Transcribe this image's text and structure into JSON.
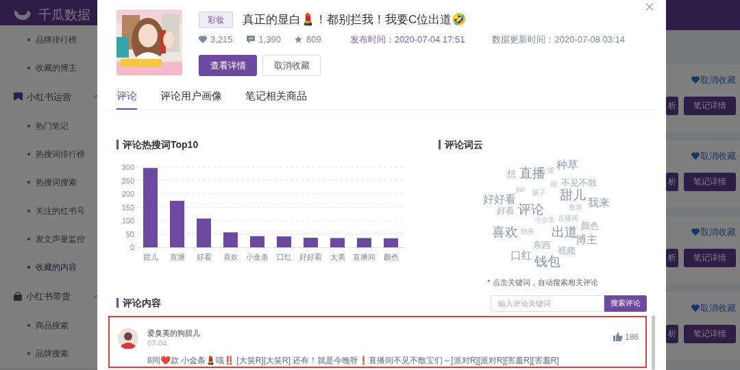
{
  "header": {
    "logo_text": "千瓜数据"
  },
  "sidebar": {
    "items": [
      {
        "kind": "link",
        "label": "品牌排行榜",
        "selected": false
      },
      {
        "kind": "link",
        "label": "收藏的博主",
        "selected": false
      },
      {
        "kind": "section",
        "label": "小红书运营",
        "expanded": true
      },
      {
        "kind": "link",
        "label": "热门笔记",
        "selected": false
      },
      {
        "kind": "link",
        "label": "热搜词排行榜",
        "selected": false
      },
      {
        "kind": "link",
        "label": "热搜词搜索",
        "selected": false
      },
      {
        "kind": "link",
        "label": "关注的红书号",
        "selected": false
      },
      {
        "kind": "link",
        "label": "发文声量监控",
        "selected": false
      },
      {
        "kind": "link",
        "label": "收藏的内容",
        "selected": true
      },
      {
        "kind": "section",
        "label": "小红书带货",
        "expanded": true
      },
      {
        "kind": "link",
        "label": "商品搜索",
        "selected": false
      },
      {
        "kind": "link",
        "label": "品牌搜索",
        "selected": false
      }
    ]
  },
  "background_cards": [
    {
      "unfavorite": "取消收藏",
      "buttons": [
        "析",
        "笔记详情"
      ]
    },
    {
      "unfavorite": "取消收藏",
      "buttons": [
        "析",
        "笔记详情"
      ]
    },
    {
      "unfavorite": "取消收藏",
      "buttons": [
        "析",
        "笔记详情"
      ]
    },
    {
      "unfavorite": "取消收藏",
      "buttons": [
        "析",
        "笔记详情"
      ]
    }
  ],
  "modal": {
    "note": {
      "tag": "彩妆",
      "title": "真正的显白💄！都别拦我！我要C位出道🤣",
      "likes": "3,215",
      "comments": "1,390",
      "favorites": "809",
      "publish_label": "发布时间：",
      "publish_time": "2020-07-04 17:51",
      "update_label": "数据更新时间：",
      "update_time": "2020-07-08 03:14"
    },
    "actions": [
      {
        "label": "查看详情",
        "kind": "primary"
      },
      {
        "label": "取消收藏",
        "kind": "secondary"
      }
    ],
    "tabs": [
      {
        "label": "评论",
        "selected": true
      },
      {
        "label": "评论用户画像",
        "selected": false
      },
      {
        "label": "笔记相关商品",
        "selected": false
      }
    ],
    "hot_words": {
      "title": "评论热搜词Top10",
      "chart_data": {
        "type": "bar",
        "categories": [
          "甜儿",
          "直播",
          "好看",
          "喜欢",
          "小金条",
          "口红",
          "好好看",
          "太美",
          "直播间",
          "颜色"
        ],
        "values": [
          297,
          174,
          108,
          56,
          42,
          41,
          36,
          35,
          35,
          34
        ],
        "ylim": [
          0,
          300
        ],
        "grid": true,
        "yticks": [
          0,
          50,
          100,
          150,
          200,
          250,
          300
        ]
      }
    },
    "word_cloud": {
      "title": "评论词云",
      "words": [
        {
          "text": "种草",
          "kind": "medium"
        },
        {
          "text": "想",
          "kind": "small"
        },
        {
          "text": "直播",
          "kind": "large"
        },
        {
          "text": "望",
          "kind": "tiny"
        },
        {
          "text": "期",
          "kind": "tiny"
        },
        {
          "text": "不见不散",
          "kind": "small"
        },
        {
          "text": "ysl",
          "kind": "tiny"
        },
        {
          "text": "孩子",
          "kind": "tiny"
        },
        {
          "text": "好好看",
          "kind": "medium"
        },
        {
          "text": "甜儿",
          "kind": "large"
        },
        {
          "text": "推荐",
          "kind": "tiny"
        },
        {
          "text": "我来",
          "kind": "medium"
        },
        {
          "text": "好看",
          "kind": "small"
        },
        {
          "text": "评论",
          "kind": "large"
        },
        {
          "text": "小金条",
          "kind": "micro"
        },
        {
          "text": "直播间",
          "kind": "micro"
        },
        {
          "text": "喜欢",
          "kind": "large"
        },
        {
          "text": "颜色",
          "kind": "small"
        },
        {
          "text": "绝美",
          "kind": "tiny"
        },
        {
          "text": "出道",
          "kind": "large"
        },
        {
          "text": "东西",
          "kind": "small"
        },
        {
          "text": "博主",
          "kind": "medium"
        },
        {
          "text": "视频",
          "kind": "small"
        },
        {
          "text": "口红",
          "kind": "medium"
        },
        {
          "text": "钱包",
          "kind": "large"
        }
      ],
      "hint": "* 点击关键词，自动搜索相关评论"
    },
    "comment_search": {
      "placeholder": "输入评论关键词",
      "button": "搜索评论"
    },
    "comments": {
      "title": "评论内容",
      "items": [
        {
          "author": "爱臭美的狗甜儿",
          "date": "07-04",
          "likes": "186",
          "text": "8同❤️款 小金条💄哦‼️ [大笑R][大笑R] 还有！就是今晚呀❗直播间不见不散宝们～[派对R][派对R][害羞R][害羞R]",
          "highlighted": true
        }
      ]
    }
  }
}
